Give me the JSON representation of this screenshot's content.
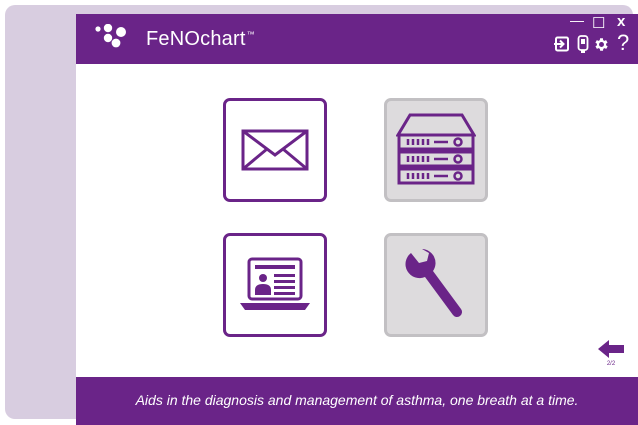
{
  "app": {
    "title": "FeNOchart",
    "trademark": "™"
  },
  "window_controls": {
    "minimize": "—",
    "maximize": "☐",
    "close": "x"
  },
  "toolbar": {
    "icons": [
      "logout-icon",
      "device-icon",
      "settings-icon",
      "help-icon"
    ],
    "help_glyph": "?"
  },
  "menu": {
    "tiles": [
      {
        "icon": "envelope-icon",
        "state": "active"
      },
      {
        "icon": "server-icon",
        "state": "disabled"
      },
      {
        "icon": "laptop-profile-icon",
        "state": "active"
      },
      {
        "icon": "wrench-icon",
        "state": "disabled"
      }
    ]
  },
  "navigation": {
    "page_indicator": "2/2"
  },
  "footer": {
    "tagline": "Aids in the diagnosis and management of asthma, one breath at a time."
  },
  "colors": {
    "brand_purple": "#6a2488",
    "frame_lavender": "#d8cde0",
    "disabled_tile": "#dddbdd"
  }
}
